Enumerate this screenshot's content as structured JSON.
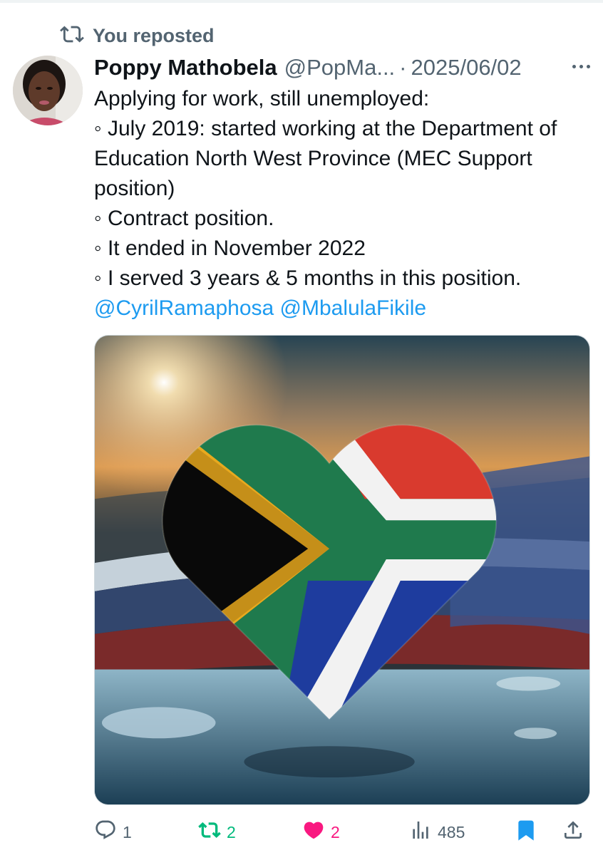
{
  "repost_banner": {
    "label": "You reposted",
    "icon": "repost-icon"
  },
  "author": {
    "name": "Poppy Mathobela",
    "handle": "@PopMa...",
    "separator": "·",
    "date": "2025/06/02"
  },
  "tweet": {
    "line1": "Applying for work, still unemployed:",
    "line2": "◦ July 2019: started working at the Department of Education North West Province (MEC Support position)",
    "line3": "◦  Contract position.",
    "line4": "◦ It ended in November 2022",
    "line5": "◦ I served 3 years & 5 months in this position.",
    "mentions": [
      "@CyrilRamaphosa",
      "@MbalulaFikile"
    ]
  },
  "actions": {
    "reply_count": "1",
    "repost_count": "2",
    "like_count": "2",
    "views_count": "485"
  },
  "colors": {
    "accent_link": "#1d9bf0",
    "repost_active": "#00ba7c",
    "like_active": "#f91880",
    "bookmark_active": "#1d9bf0",
    "muted": "#536471"
  }
}
